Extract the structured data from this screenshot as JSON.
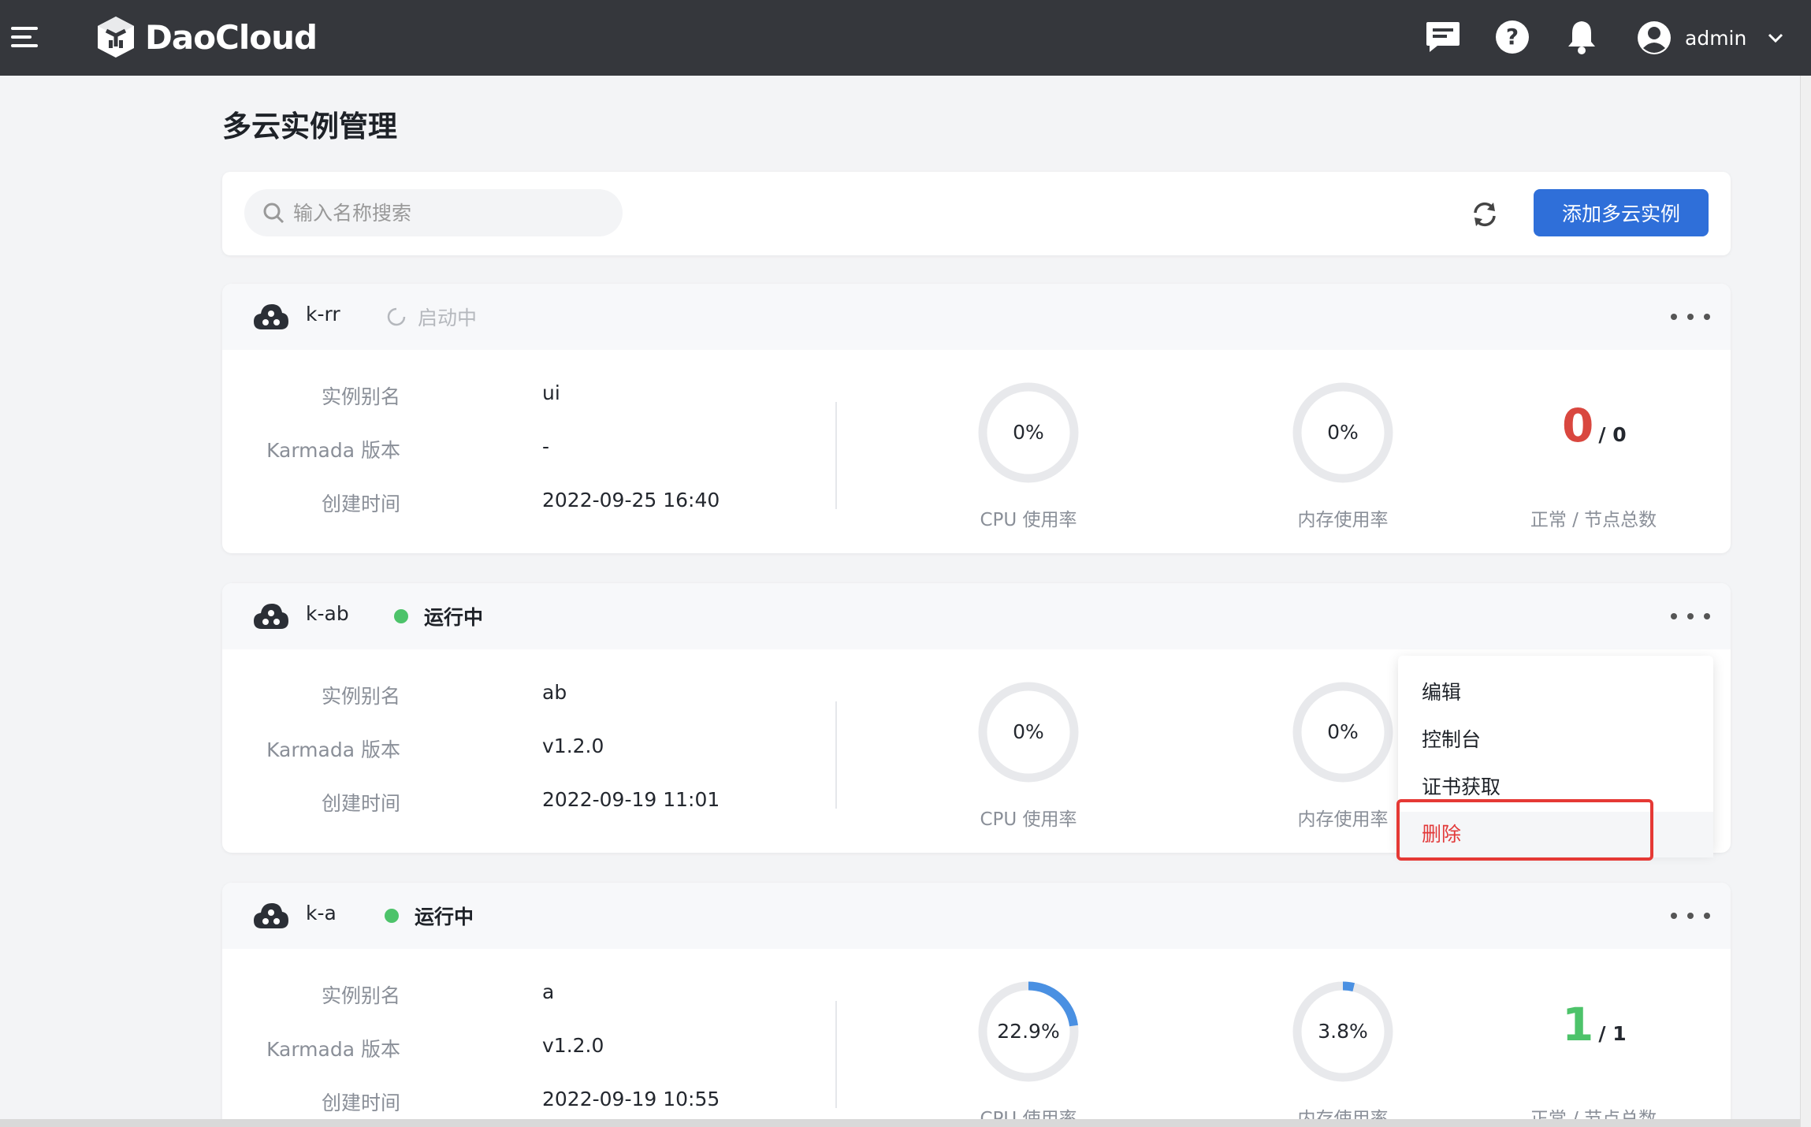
{
  "topbar": {
    "brand": "DaoCloud",
    "username": "admin"
  },
  "page": {
    "title": "多云实例管理"
  },
  "toolbar": {
    "search_placeholder": "输入名称搜索",
    "add_label": "添加多云实例"
  },
  "labels": {
    "alias": "实例别名",
    "karmada": "Karmada 版本",
    "created": "创建时间",
    "cpu": "CPU 使用率",
    "mem": "内存使用率",
    "nodes": "正常 / 节点总数"
  },
  "colors": {
    "accent": "#2f6fd9",
    "running": "#4dc36a",
    "danger": "#e23a3a",
    "nodes_zero": "#d9473f",
    "nodes_ok": "#4dc36a",
    "gauge_track": "#e8e9ec",
    "gauge_fill": "#4a90e2"
  },
  "instances": [
    {
      "name": "k-rr",
      "status": "启动中",
      "status_kind": "starting",
      "alias": "ui",
      "karmada_version": "-",
      "created": "2022-09-25 16:40",
      "cpu_text": "0%",
      "cpu_value": 0,
      "mem_text": "0%",
      "mem_value": 0,
      "nodes_normal": "0",
      "nodes_total": "/ 0"
    },
    {
      "name": "k-ab",
      "status": "运行中",
      "status_kind": "running",
      "alias": "ab",
      "karmada_version": "v1.2.0",
      "created": "2022-09-19 11:01",
      "cpu_text": "0%",
      "cpu_value": 0,
      "mem_text": "0%",
      "mem_value": 0,
      "nodes_normal": "",
      "nodes_total": ""
    },
    {
      "name": "k-a",
      "status": "运行中",
      "status_kind": "running",
      "alias": "a",
      "karmada_version": "v1.2.0",
      "created": "2022-09-19 10:55",
      "cpu_text": "22.9%",
      "cpu_value": 22.9,
      "mem_text": "3.8%",
      "mem_value": 3.8,
      "nodes_normal": "1",
      "nodes_total": "/ 1"
    }
  ],
  "menu": {
    "items": [
      "编辑",
      "控制台",
      "证书获取",
      "删除"
    ]
  }
}
